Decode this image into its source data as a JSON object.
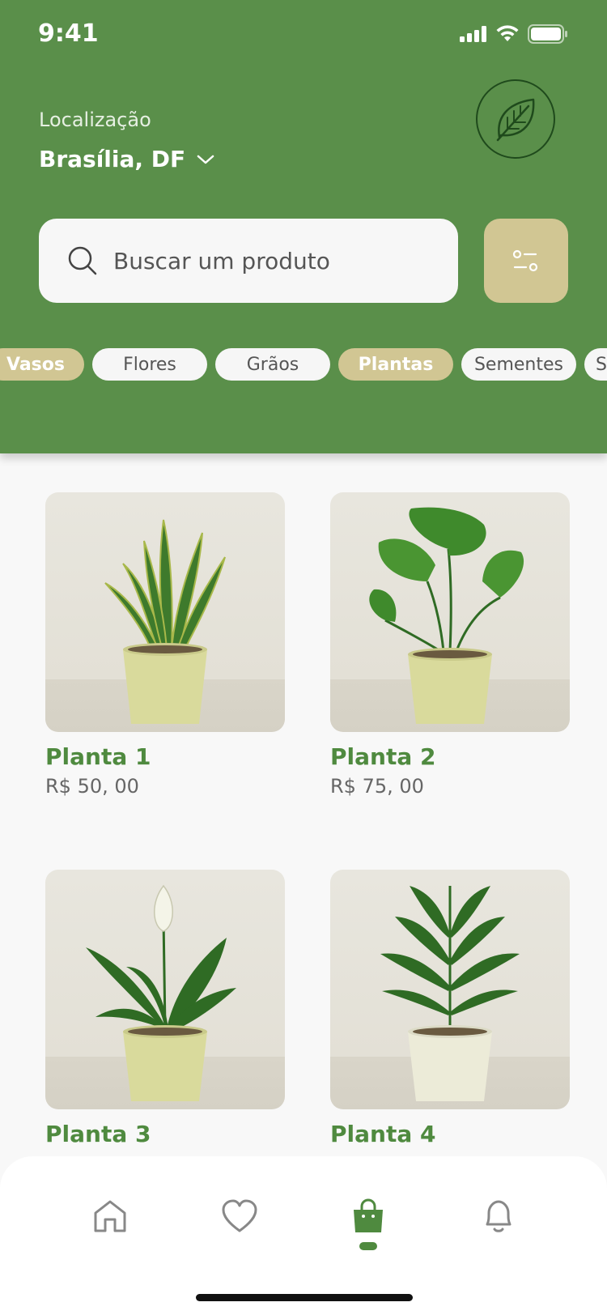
{
  "status_bar": {
    "time": "9:41"
  },
  "location": {
    "label": "Localização",
    "value": "Brasília, DF"
  },
  "search": {
    "placeholder": "Buscar um produto"
  },
  "categories": [
    {
      "label": "Vasos",
      "active": true
    },
    {
      "label": "Flores",
      "active": false
    },
    {
      "label": "Grãos",
      "active": false
    },
    {
      "label": "Plantas",
      "active": true
    },
    {
      "label": "Sementes",
      "active": false
    },
    {
      "label": "S",
      "active": false
    }
  ],
  "products": [
    {
      "name": "Planta 1",
      "price": "R$ 50, 00"
    },
    {
      "name": "Planta 2",
      "price": "R$ 75, 00"
    },
    {
      "name": "Planta 3",
      "price": ""
    },
    {
      "name": "Planta 4",
      "price": ""
    }
  ],
  "bottom_nav": {
    "items": [
      "home-icon",
      "heart-icon",
      "shopping-bag-icon",
      "bell-icon"
    ],
    "active": "shopping-bag-icon"
  },
  "colors": {
    "brand_green": "#5a8f4a",
    "accent_tan": "#d1c693",
    "text_green": "#4f8a3f"
  }
}
